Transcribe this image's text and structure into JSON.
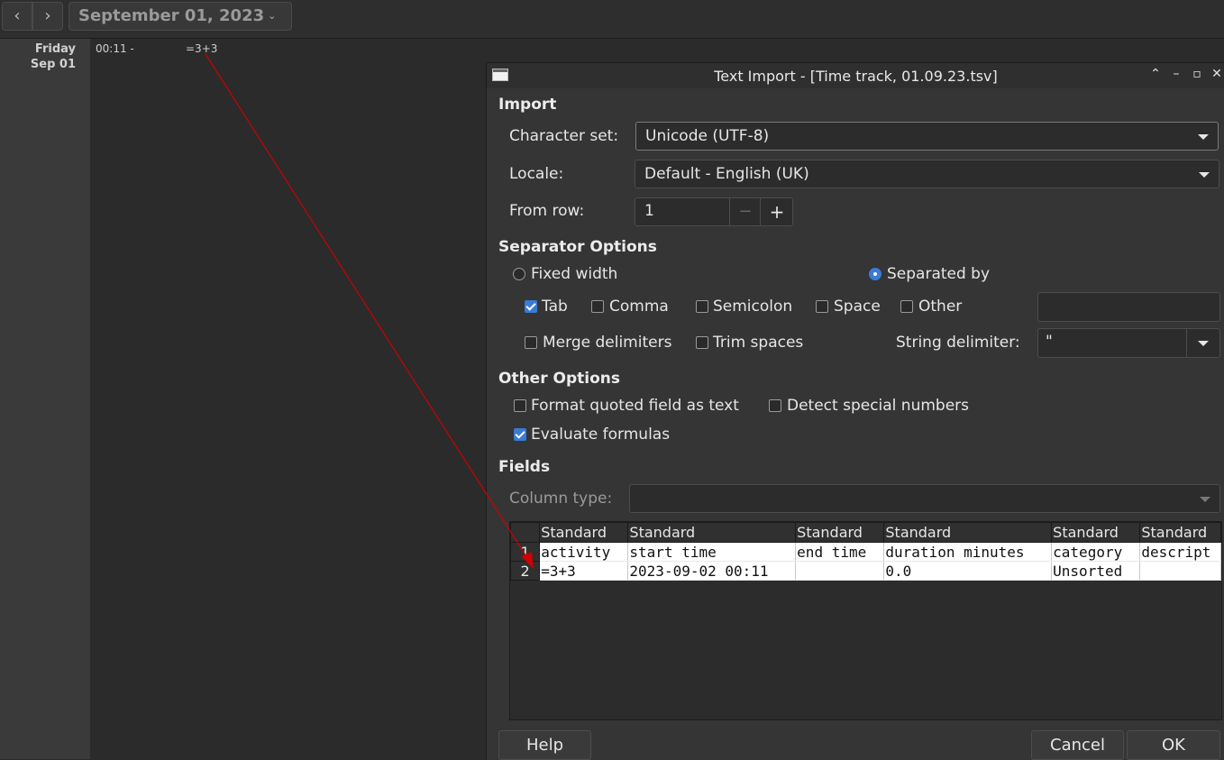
{
  "app": {
    "nav_prev_icon": "chevron-left-icon",
    "nav_next_icon": "chevron-right-icon",
    "date_label": "September 01, 2023",
    "day_name": "Friday",
    "day_date": "Sep 01",
    "entry": {
      "time": "00:11 -",
      "activity": "=3+3"
    }
  },
  "dialog": {
    "title": "Text Import - [Time track, 01.09.23.tsv]",
    "import": {
      "heading": "Import",
      "charset_label": "Character set:",
      "charset_value": "Unicode (UTF-8)",
      "locale_label": "Locale:",
      "locale_value": "Default - English (UK)",
      "from_row_label": "From row:",
      "from_row_value": "1"
    },
    "separator": {
      "heading": "Separator Options",
      "fixed_width": "Fixed width",
      "separated_by": "Separated by",
      "mode": "separated",
      "tab": "Tab",
      "comma": "Comma",
      "semicolon": "Semicolon",
      "space": "Space",
      "other": "Other",
      "merge": "Merge delimiters",
      "trim": "Trim spaces",
      "string_delim_label": "String delimiter:",
      "string_delim_value": "\"",
      "checked": {
        "tab": true,
        "comma": false,
        "semicolon": false,
        "space": false,
        "other": false,
        "merge": false,
        "trim": false
      }
    },
    "other": {
      "heading": "Other Options",
      "format_quoted": "Format quoted field as text",
      "detect_special": "Detect special numbers",
      "evaluate": "Evaluate formulas",
      "checked": {
        "format_quoted": false,
        "detect_special": false,
        "evaluate": true
      }
    },
    "fields": {
      "heading": "Fields",
      "column_type_label": "Column type:",
      "column_type_value": "",
      "headers": [
        "Standard",
        "Standard",
        "Standard",
        "Standard",
        "Standard",
        "Standard"
      ],
      "rows": [
        {
          "num": "1",
          "cells": [
            "activity",
            "start time",
            "end time",
            "duration minutes",
            "category",
            "descript"
          ]
        },
        {
          "num": "2",
          "cells": [
            "=3+3",
            "2023-09-02 00:11",
            "",
            "0.0",
            "Unsorted",
            ""
          ]
        }
      ]
    },
    "buttons": {
      "help": "Help",
      "cancel": "Cancel",
      "ok": "OK"
    }
  },
  "colors": {
    "accent": "#3a7bd5",
    "arrow": "#cc0000",
    "background": "#2b2b2b",
    "dialog": "#353535"
  }
}
